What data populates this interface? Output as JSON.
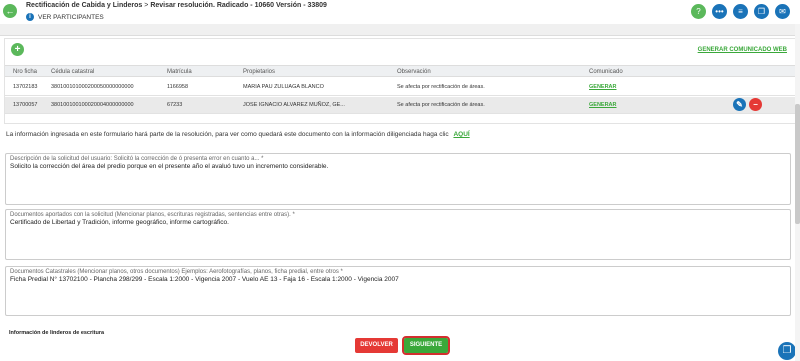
{
  "header": {
    "breadcrumb_1": "Rectificación de Cabida y Linderos",
    "breadcrumb_sep": ">",
    "breadcrumb_2": "Revisar resolución. Radicado - 10660 Versión - 33809",
    "participants_label": "VER PARTICIPANTES",
    "back_icon": "←",
    "info_icon": "i",
    "icons": [
      {
        "name": "help-icon",
        "glyph": "?"
      },
      {
        "name": "more-icon",
        "glyph": "•••"
      },
      {
        "name": "document-icon",
        "glyph": "≡"
      },
      {
        "name": "copy-icon",
        "glyph": "❐"
      },
      {
        "name": "chat-icon",
        "glyph": "✉"
      }
    ]
  },
  "table": {
    "add_icon": "+",
    "generate_web_label": "GENERAR COMUNICADO WEB",
    "columns": [
      "Nro ficha",
      "Cédula catastral",
      "Matrícula",
      "Propietarios",
      "Observación",
      "Comunicado"
    ],
    "rows": [
      {
        "nro": "13702183",
        "cedula": "380100101000200050000000000",
        "matricula": "1166958",
        "propietarios": "MARIA PAU ZULUAGA BLANCO",
        "observacion": "Se afecta por rectificación de áreas.",
        "comunicado": "GENERAR"
      },
      {
        "nro": "13700057",
        "cedula": "380100100100020004000000000",
        "matricula": "67233",
        "propietarios": "JOSE IGNACIO ALVAREZ MUÑOZ, GE...",
        "observacion": "Se afecta por rectificación de áreas.",
        "comunicado": "GENERAR"
      }
    ],
    "edit_icon": "✎",
    "delete_icon": "−"
  },
  "info_text": "La información ingresada en este formulario hará parte de la resolución, para ver como quedará este documento con la información diligenciada haga clic",
  "info_link": "AQUÍ",
  "fields": [
    {
      "label": "Descripción de la solicitud del usuario: Solicitó la corrección de ó presenta error en cuanto a... *",
      "value": "Solicito la corrección del área del predio porque en el presente año el avaluó tuvo un incremento considerable."
    },
    {
      "label": "Documentos aportados con la solicitud (Mencionar planos, escrituras registradas, sentencias entre otras). *",
      "value": "Certificado de Libertad y Tradición, informe geográfico, informe cartográfico."
    },
    {
      "label": "Documentos Catastrales (Mencionar planos, otros documentos) Ejemplos: Aerofotografías, planos, ficha predial, entre otros *",
      "value": "Ficha Predial N° 13702100 - Plancha 298/299 - Escala 1:2000 - Vigencia 2007 - Vuelo AE 13 - Faja 16 - Escala 1:2000 - Vigencia 2007"
    }
  ],
  "linderos_label": "Información de linderos de escritura",
  "footer": {
    "back_label": "DEVOLVER",
    "next_label": "SIGUIENTE",
    "fab_icon": "❐"
  }
}
